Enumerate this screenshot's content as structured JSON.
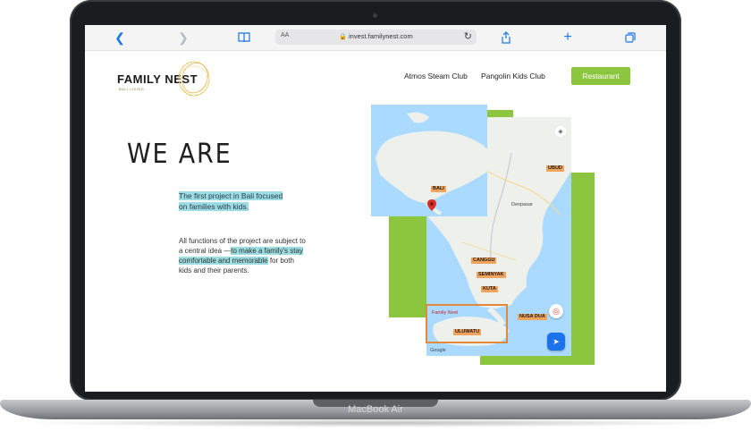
{
  "device": {
    "label": "MacBook Air"
  },
  "browser": {
    "text_size_label": "AA",
    "url": "invest.familynest.com",
    "icons": {
      "back": "chevron-left-icon",
      "forward": "chevron-right-icon",
      "bookmarks": "book-icon",
      "lock": "lock-icon",
      "reload": "reload-icon",
      "share": "share-icon",
      "new_tab": "plus-icon",
      "tabs": "tabs-icon"
    }
  },
  "site": {
    "logo": {
      "word": "FAMILY NEST",
      "sub": "BALI LIVING"
    },
    "nav": {
      "atmos": "Atmos Steam Club",
      "pangolin": "Pangolin Kids Club",
      "restaurant": "Restaurant"
    },
    "headline": "WE ARE",
    "intro": "The first project in Bali focused on families with kids.",
    "body_part1": "All functions of the project are subject to a central idea —",
    "body_highlight": "to make a family's stay comfortable and memorable",
    "body_part2": " for both kids and their parents."
  },
  "map": {
    "inset_labels": {
      "bali": "BALI"
    },
    "labels": {
      "ubud": "UBUD",
      "canggu": "CANGGU",
      "seminyak": "SEMINYAK",
      "kuta": "KUTA",
      "nusa_dua": "NUSA DUA",
      "uluwatu": "ULUWATU"
    },
    "texts": {
      "denpasar": "Denpasar",
      "family_nest": "Family Nest",
      "google": "Google"
    }
  },
  "colors": {
    "accent_green": "#8cc63f",
    "highlight": "#9bdde0",
    "map_water": "#aadaff",
    "label_orange": "#f3a35b"
  }
}
